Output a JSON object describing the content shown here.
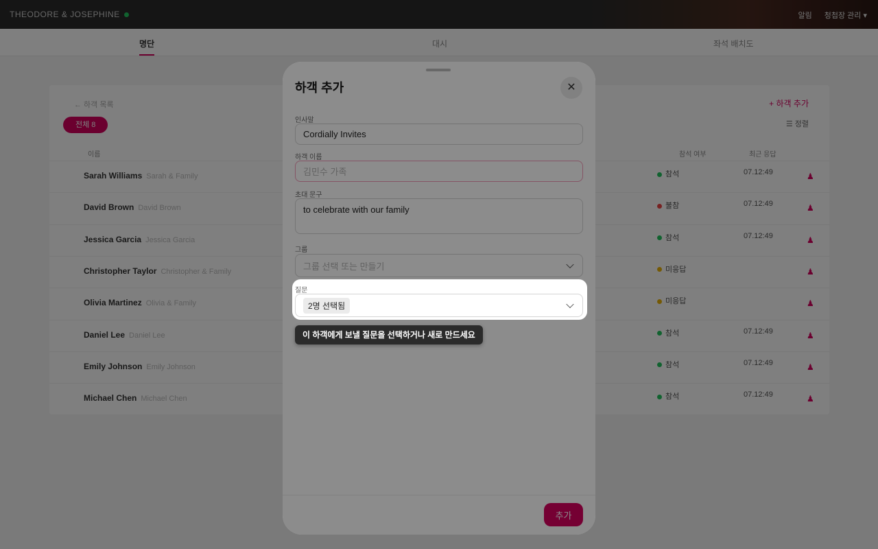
{
  "app": {
    "title": "THEODORE & JOSEPHINE",
    "topbar_right": [
      "알림",
      "청첩장 관리 ▾"
    ]
  },
  "tabs": [
    "명단",
    "대시",
    "좌석 배치도"
  ],
  "background": {
    "breadcrumb": "← 하객 목록",
    "add_link": "+ 하객 추가",
    "filter_pill": "전체 8",
    "sort_button": "☰ 정렬",
    "headers": [
      "이름",
      "참석 여부",
      "최근 응답"
    ],
    "rows": [
      {
        "name": "Sarah Williams",
        "sub": "Sarah & Family",
        "status": "참석",
        "status_color": "#22c55e",
        "time": "07.12:49"
      },
      {
        "name": "David Brown",
        "sub": "David Brown",
        "status": "불참",
        "status_color": "#ef4444",
        "time": "07.12:49"
      },
      {
        "name": "Jessica Garcia",
        "sub": "Jessica Garcia",
        "status": "참석",
        "status_color": "#22c55e",
        "time": "07.12:49"
      },
      {
        "name": "Christopher Taylor",
        "sub": "Christopher & Family",
        "status": "미응답",
        "status_color": "#eab308",
        "time": ""
      },
      {
        "name": "Olivia Martinez",
        "sub": "Olivia & Family",
        "status": "미응답",
        "status_color": "#eab308",
        "time": ""
      },
      {
        "name": "Daniel Lee",
        "sub": "Daniel Lee",
        "status": "참석",
        "status_color": "#22c55e",
        "time": "07.12:49"
      },
      {
        "name": "Emily Johnson",
        "sub": "Emily Johnson",
        "status": "참석",
        "status_color": "#22c55e",
        "time": "07.12:49"
      },
      {
        "name": "Michael Chen",
        "sub": "Michael Chen",
        "status": "참석",
        "status_color": "#22c55e",
        "time": "07.12:49"
      }
    ]
  },
  "modal": {
    "title": "하객 추가",
    "greeting_label": "인사말",
    "greeting_value": "Cordially Invites",
    "guest_name_label": "하객 이름",
    "guest_name_placeholder": "김민수 가족",
    "invite_text_label": "초대 문구",
    "invite_text_value": "to celebrate with our family",
    "group_label": "그룹",
    "group_placeholder": "그룹 선택 또는 만들기",
    "questions_label": "질문",
    "questions_value": "2명 선택됨",
    "submit_label": "추가"
  },
  "tooltip": "이 하객에게 보낼 질문을 선택하거나 새로 만드세요",
  "colors": {
    "accent": "#d6005e",
    "overlay": "rgba(0,0,0,0.5)"
  }
}
